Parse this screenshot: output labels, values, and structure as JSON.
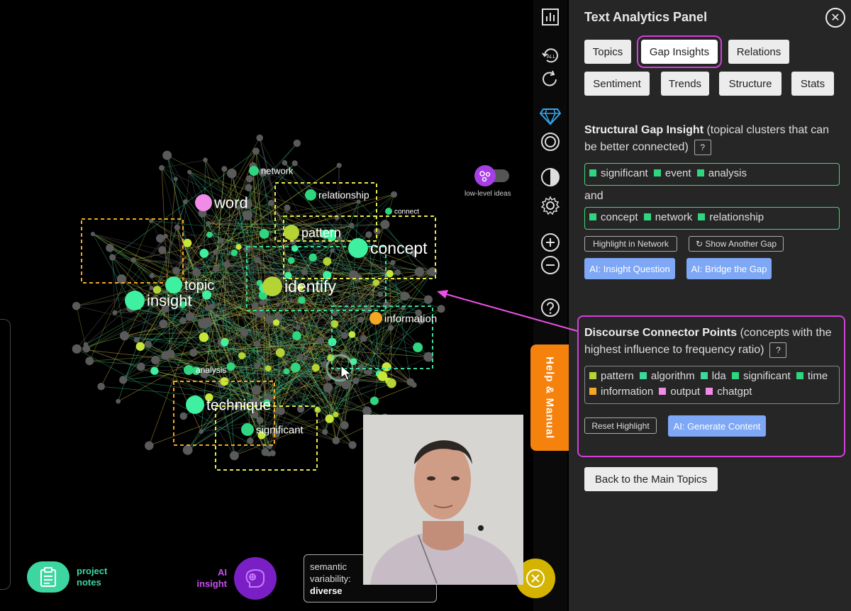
{
  "panel": {
    "title": "Text Analytics Panel",
    "tabs_row1": [
      "Topics",
      "Gap Insights",
      "Relations"
    ],
    "tabs_row2": [
      "Sentiment",
      "Trends",
      "Structure",
      "Stats"
    ],
    "active_tab": "Gap Insights",
    "gap": {
      "heading_bold": "Structural Gap Insight",
      "heading_rest": " (topical clusters that can be better connected)",
      "help": "?",
      "cluster1": [
        "significant",
        "event",
        "analysis"
      ],
      "and_label": "and",
      "cluster2": [
        "concept",
        "network",
        "relationship"
      ],
      "highlight_btn": "Highlight in Network",
      "show_another_btn": "↻ Show Another Gap",
      "ai_question_btn": "AI: Insight Question",
      "ai_bridge_btn": "AI: Bridge the Gap"
    },
    "connectors": {
      "heading_bold": "Discourse Connector Points",
      "heading_rest": " (concepts with the highest influence to frequency ratio)",
      "help": "?",
      "items": [
        {
          "label": "pattern",
          "color": "#b5d334"
        },
        {
          "label": "algorithm",
          "color": "#3ed99a"
        },
        {
          "label": "lda",
          "color": "#3ed99a"
        },
        {
          "label": "significant",
          "color": "#2fd57f"
        },
        {
          "label": "time",
          "color": "#2fd57f"
        },
        {
          "label": "information",
          "color": "#f5a623"
        },
        {
          "label": "output",
          "color": "#f08ce8"
        },
        {
          "label": "chatgpt",
          "color": "#f08ce8"
        }
      ],
      "reset_btn": "Reset Highlight",
      "ai_generate_btn": "AI: Generate Content"
    },
    "back_btn": "Back to the Main Topics"
  },
  "help_tab": "Help & Manual",
  "toggle_label": "low-level ideas",
  "bottom": {
    "project_notes": "project notes",
    "ai_insight": "AI insight",
    "semantic_label": "semantic variability:",
    "semantic_value": "diverse"
  },
  "graph": {
    "labels": [
      {
        "text": "network",
        "size": 13,
        "color": "#2fd57f"
      },
      {
        "text": "relationship",
        "size": 14,
        "color": "#2fd57f"
      },
      {
        "text": "connect",
        "size": 10,
        "color": "#2fd57f"
      },
      {
        "text": "word",
        "size": 22,
        "color": "#f08ce8"
      },
      {
        "text": "pattern",
        "size": 18,
        "color": "#b5d334"
      },
      {
        "text": "concept",
        "size": 23,
        "color": "#3ef0a0"
      },
      {
        "text": "topic",
        "size": 20,
        "color": "#3ef0a0"
      },
      {
        "text": "insight",
        "size": 22,
        "color": "#3ef0a0"
      },
      {
        "text": "identify",
        "size": 23,
        "color": "#b5d334"
      },
      {
        "text": "information",
        "size": 15,
        "color": "#f5a623"
      },
      {
        "text": "analysis",
        "size": 12,
        "color": "#2fd57f"
      },
      {
        "text": "technique",
        "size": 21,
        "color": "#3ef0a0"
      },
      {
        "text": "significant",
        "size": 15,
        "color": "#2fd57f"
      }
    ]
  },
  "colors": {
    "accent_magenta": "#d33fd9",
    "green_border": "#3ed97a",
    "ai_button": "#7ea7f5",
    "help_orange": "#f5820d"
  }
}
